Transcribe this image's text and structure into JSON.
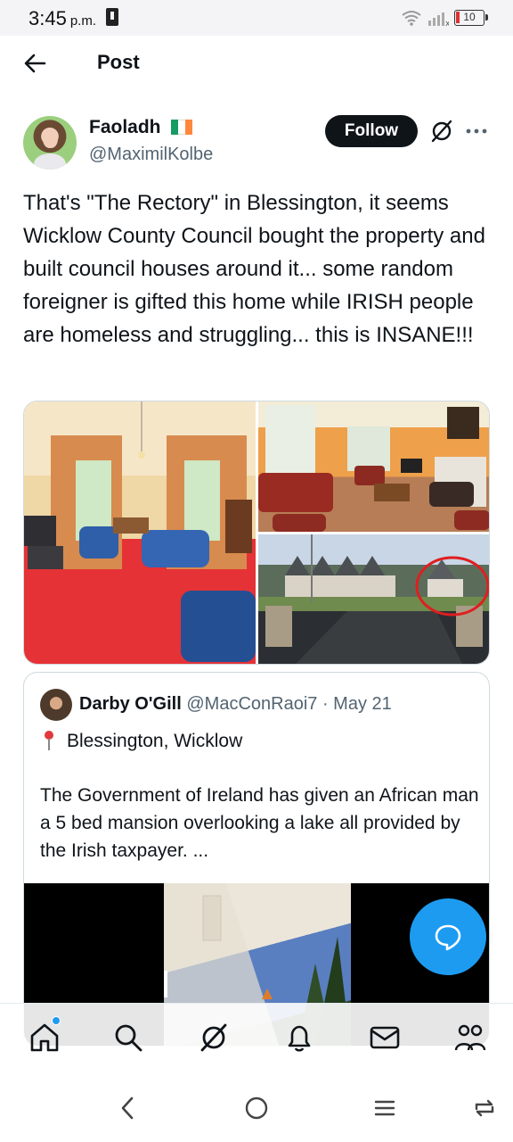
{
  "status_bar": {
    "time": "3:45",
    "ampm": "p.m.",
    "battery": "10",
    "icons": [
      "lock-icon",
      "wifi-icon",
      "signal-icon",
      "battery-icon"
    ]
  },
  "header": {
    "title": "Post",
    "back_icon": "back-arrow-icon"
  },
  "post": {
    "author_name": "Faoladh",
    "author_handle": "@MaximilKolbe",
    "flag_colors": [
      "#169b62",
      "#ffffff",
      "#ff883e"
    ],
    "follow_label": "Follow",
    "text": "That's \"The Rectory\" in Blessington, it seems Wicklow County Council bought the property and built council houses around it... some random foreigner is gifted this home while IRISH people are homeless and struggling... this is INSANE!!!",
    "media_count": 3
  },
  "quote": {
    "author_name": "Darby O'Gill",
    "author_handle": "@MacConRaoi7",
    "separator": " · ",
    "date": "May 21",
    "location": "Blessington, Wicklow",
    "text": "The Government of Ireland has given an African man a 5 bed mansion overlooking a lake all provided by the Irish taxpayer. ..."
  },
  "fab": {
    "icon": "reply-bubble-icon"
  },
  "tabbar": {
    "items": [
      {
        "icon": "home-icon",
        "has_notification_dot": true
      },
      {
        "icon": "search-icon"
      },
      {
        "icon": "grok-icon"
      },
      {
        "icon": "bell-icon"
      },
      {
        "icon": "mail-icon"
      },
      {
        "icon": "communities-icon"
      }
    ]
  },
  "system_nav": {
    "items": [
      "back-chevron-icon",
      "home-circle-icon",
      "menu-lines-icon",
      "rotate-icon"
    ]
  },
  "colors": {
    "accent": "#1d9bf0",
    "text_primary": "#0f1419",
    "text_secondary": "#536471",
    "follow_bg": "#0f1419"
  }
}
